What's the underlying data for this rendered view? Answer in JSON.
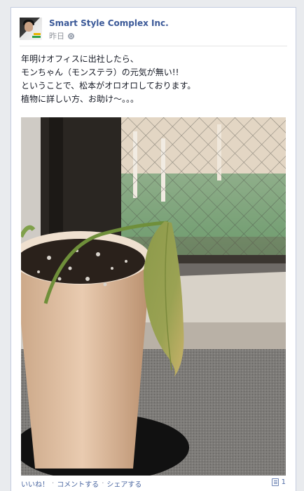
{
  "post": {
    "author": "Smart Style Complex Inc.",
    "timestamp": "昨日",
    "privacy_icon": "globe-icon",
    "text_lines": [
      "年明けオフィスに出社したら、",
      "モンちゃん（モンステラ）の元気が無い!!",
      "ということで、松本がオロオロしております。",
      "植物に詳しい方、お助け〜。。。"
    ]
  },
  "actions": {
    "like": "いいね！",
    "comment": "コメントする",
    "share": "シェアする",
    "separator": "·",
    "comment_count": "1"
  },
  "colors": {
    "link": "#3b5998",
    "border": "#c4cde0",
    "background": "#e9ebee"
  }
}
